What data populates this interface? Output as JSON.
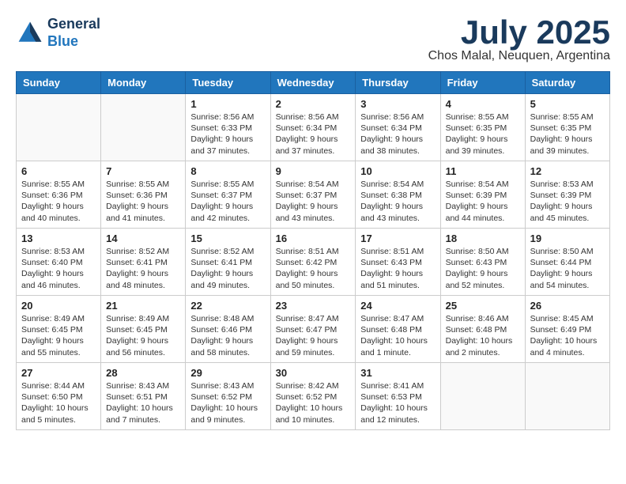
{
  "header": {
    "logo_line1": "General",
    "logo_line2": "Blue",
    "month_title": "July 2025",
    "location": "Chos Malal, Neuquen, Argentina"
  },
  "weekdays": [
    "Sunday",
    "Monday",
    "Tuesday",
    "Wednesday",
    "Thursday",
    "Friday",
    "Saturday"
  ],
  "weeks": [
    [
      {
        "day": "",
        "content": ""
      },
      {
        "day": "",
        "content": ""
      },
      {
        "day": "1",
        "content": "Sunrise: 8:56 AM\nSunset: 6:33 PM\nDaylight: 9 hours and 37 minutes."
      },
      {
        "day": "2",
        "content": "Sunrise: 8:56 AM\nSunset: 6:34 PM\nDaylight: 9 hours and 37 minutes."
      },
      {
        "day": "3",
        "content": "Sunrise: 8:56 AM\nSunset: 6:34 PM\nDaylight: 9 hours and 38 minutes."
      },
      {
        "day": "4",
        "content": "Sunrise: 8:55 AM\nSunset: 6:35 PM\nDaylight: 9 hours and 39 minutes."
      },
      {
        "day": "5",
        "content": "Sunrise: 8:55 AM\nSunset: 6:35 PM\nDaylight: 9 hours and 39 minutes."
      }
    ],
    [
      {
        "day": "6",
        "content": "Sunrise: 8:55 AM\nSunset: 6:36 PM\nDaylight: 9 hours and 40 minutes."
      },
      {
        "day": "7",
        "content": "Sunrise: 8:55 AM\nSunset: 6:36 PM\nDaylight: 9 hours and 41 minutes."
      },
      {
        "day": "8",
        "content": "Sunrise: 8:55 AM\nSunset: 6:37 PM\nDaylight: 9 hours and 42 minutes."
      },
      {
        "day": "9",
        "content": "Sunrise: 8:54 AM\nSunset: 6:37 PM\nDaylight: 9 hours and 43 minutes."
      },
      {
        "day": "10",
        "content": "Sunrise: 8:54 AM\nSunset: 6:38 PM\nDaylight: 9 hours and 43 minutes."
      },
      {
        "day": "11",
        "content": "Sunrise: 8:54 AM\nSunset: 6:39 PM\nDaylight: 9 hours and 44 minutes."
      },
      {
        "day": "12",
        "content": "Sunrise: 8:53 AM\nSunset: 6:39 PM\nDaylight: 9 hours and 45 minutes."
      }
    ],
    [
      {
        "day": "13",
        "content": "Sunrise: 8:53 AM\nSunset: 6:40 PM\nDaylight: 9 hours and 46 minutes."
      },
      {
        "day": "14",
        "content": "Sunrise: 8:52 AM\nSunset: 6:41 PM\nDaylight: 9 hours and 48 minutes."
      },
      {
        "day": "15",
        "content": "Sunrise: 8:52 AM\nSunset: 6:41 PM\nDaylight: 9 hours and 49 minutes."
      },
      {
        "day": "16",
        "content": "Sunrise: 8:51 AM\nSunset: 6:42 PM\nDaylight: 9 hours and 50 minutes."
      },
      {
        "day": "17",
        "content": "Sunrise: 8:51 AM\nSunset: 6:43 PM\nDaylight: 9 hours and 51 minutes."
      },
      {
        "day": "18",
        "content": "Sunrise: 8:50 AM\nSunset: 6:43 PM\nDaylight: 9 hours and 52 minutes."
      },
      {
        "day": "19",
        "content": "Sunrise: 8:50 AM\nSunset: 6:44 PM\nDaylight: 9 hours and 54 minutes."
      }
    ],
    [
      {
        "day": "20",
        "content": "Sunrise: 8:49 AM\nSunset: 6:45 PM\nDaylight: 9 hours and 55 minutes."
      },
      {
        "day": "21",
        "content": "Sunrise: 8:49 AM\nSunset: 6:45 PM\nDaylight: 9 hours and 56 minutes."
      },
      {
        "day": "22",
        "content": "Sunrise: 8:48 AM\nSunset: 6:46 PM\nDaylight: 9 hours and 58 minutes."
      },
      {
        "day": "23",
        "content": "Sunrise: 8:47 AM\nSunset: 6:47 PM\nDaylight: 9 hours and 59 minutes."
      },
      {
        "day": "24",
        "content": "Sunrise: 8:47 AM\nSunset: 6:48 PM\nDaylight: 10 hours and 1 minute."
      },
      {
        "day": "25",
        "content": "Sunrise: 8:46 AM\nSunset: 6:48 PM\nDaylight: 10 hours and 2 minutes."
      },
      {
        "day": "26",
        "content": "Sunrise: 8:45 AM\nSunset: 6:49 PM\nDaylight: 10 hours and 4 minutes."
      }
    ],
    [
      {
        "day": "27",
        "content": "Sunrise: 8:44 AM\nSunset: 6:50 PM\nDaylight: 10 hours and 5 minutes."
      },
      {
        "day": "28",
        "content": "Sunrise: 8:43 AM\nSunset: 6:51 PM\nDaylight: 10 hours and 7 minutes."
      },
      {
        "day": "29",
        "content": "Sunrise: 8:43 AM\nSunset: 6:52 PM\nDaylight: 10 hours and 9 minutes."
      },
      {
        "day": "30",
        "content": "Sunrise: 8:42 AM\nSunset: 6:52 PM\nDaylight: 10 hours and 10 minutes."
      },
      {
        "day": "31",
        "content": "Sunrise: 8:41 AM\nSunset: 6:53 PM\nDaylight: 10 hours and 12 minutes."
      },
      {
        "day": "",
        "content": ""
      },
      {
        "day": "",
        "content": ""
      }
    ]
  ]
}
